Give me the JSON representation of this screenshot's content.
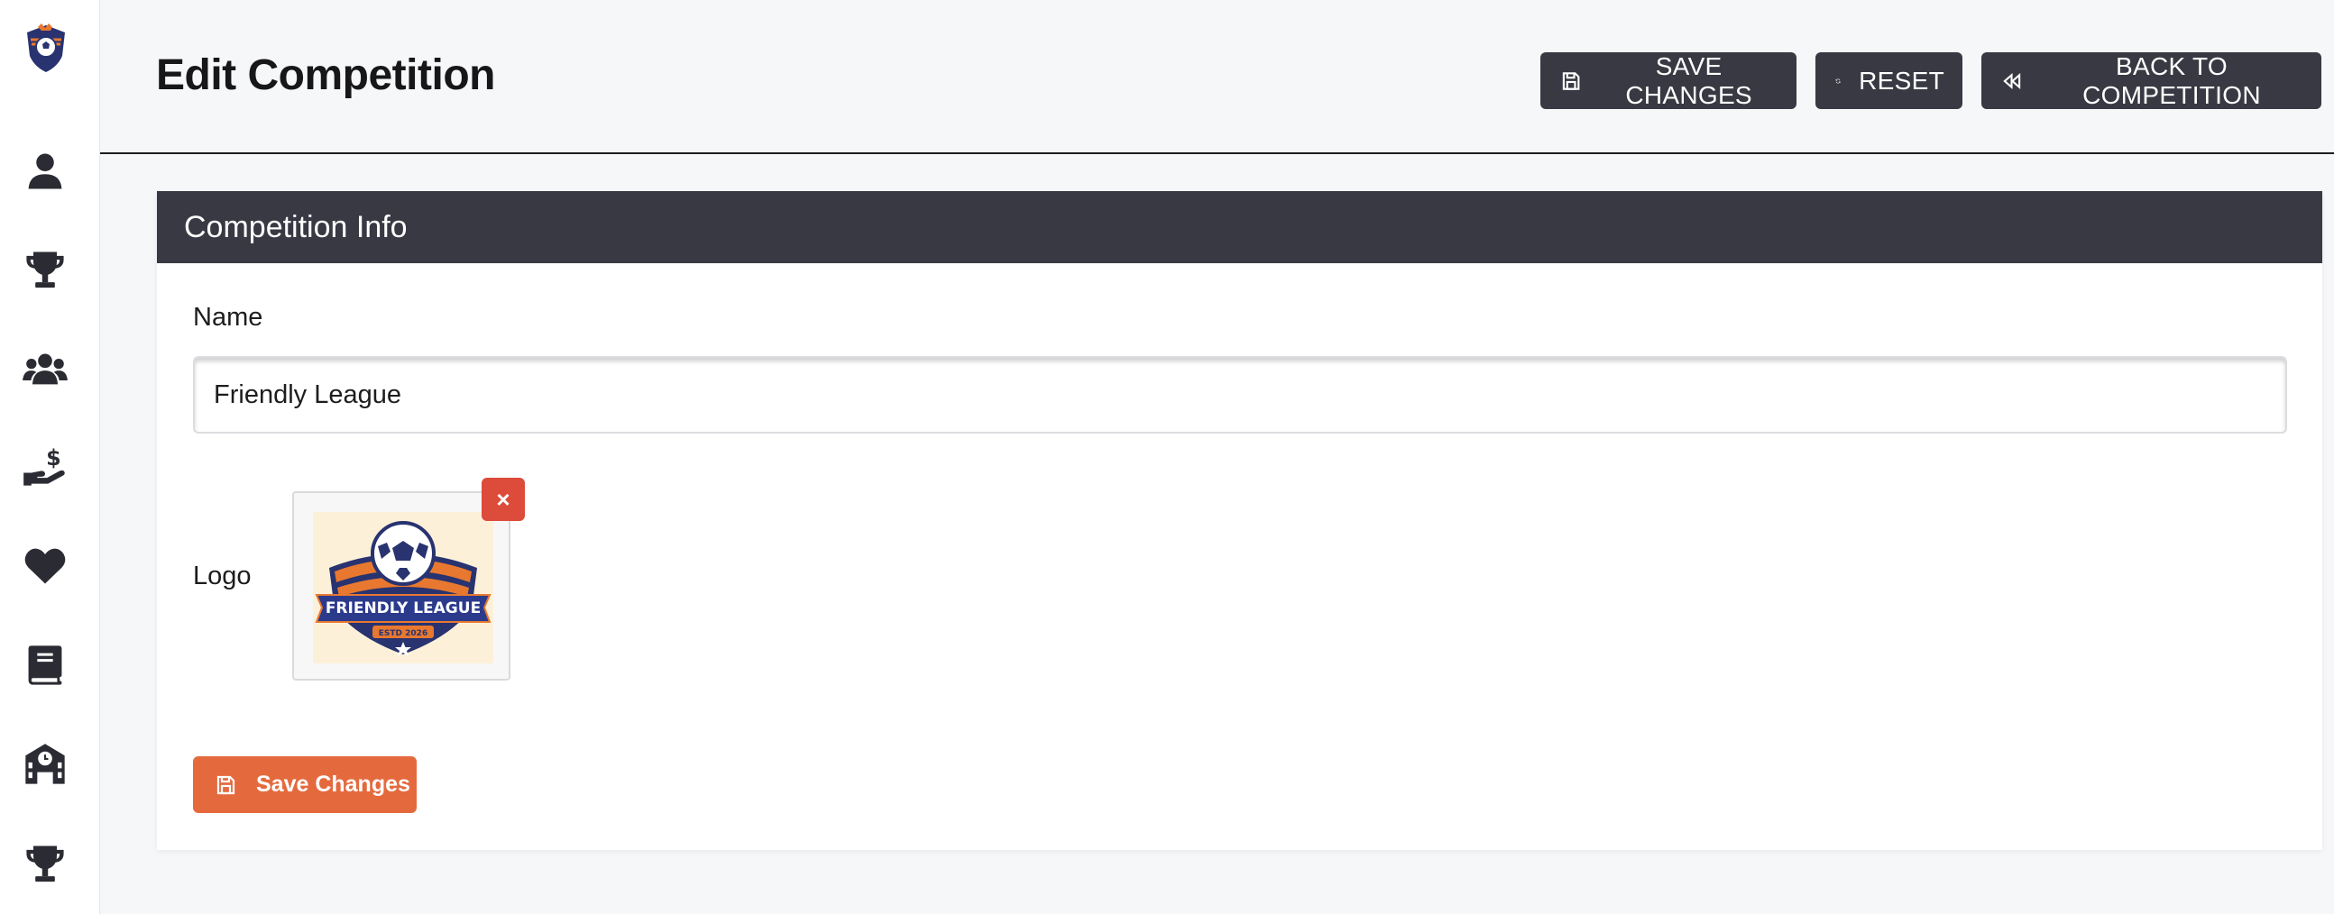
{
  "header": {
    "title": "Edit Competition",
    "buttons": {
      "save": "SAVE CHANGES",
      "reset": "RESET",
      "back": "BACK TO COMPETITION"
    }
  },
  "sidebar": {
    "items": [
      {
        "icon": "user-icon"
      },
      {
        "icon": "trophy-icon"
      },
      {
        "icon": "users-icon"
      },
      {
        "icon": "hand-holding-dollar-icon"
      },
      {
        "icon": "heart-icon"
      },
      {
        "icon": "book-icon"
      },
      {
        "icon": "school-icon"
      },
      {
        "icon": "trophy-icon"
      }
    ]
  },
  "card": {
    "title": "Competition Info",
    "name_label": "Name",
    "name_value": "Friendly League",
    "logo_label": "Logo",
    "logo_text": "FRIENDLY LEAGUE",
    "logo_subtext": "ESTD 2026",
    "remove_label": "×",
    "save_label": "Save Changes"
  },
  "colors": {
    "dark": "#383942",
    "accent": "#e46a3e",
    "danger": "#dd4b3a",
    "background": "#f6f7f9"
  }
}
